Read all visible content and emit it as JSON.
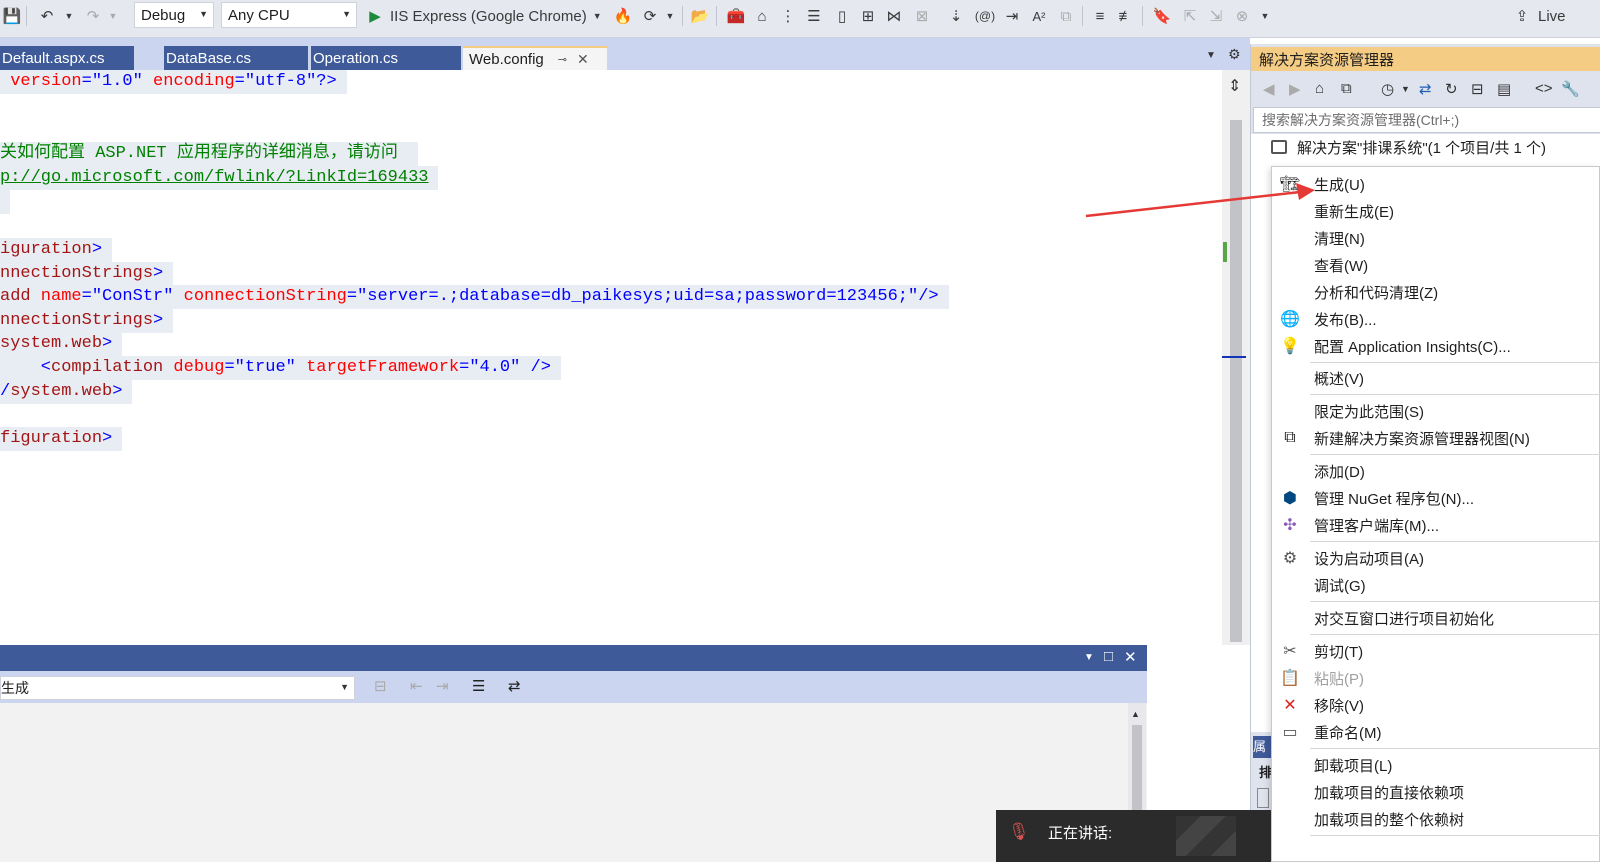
{
  "toolbar": {
    "config": "Debug",
    "platform": "Any CPU",
    "run_target": "IIS Express (Google Chrome)",
    "live_share": "Live"
  },
  "tabs": [
    {
      "label": "Default.aspx.cs",
      "active": false
    },
    {
      "label": "DataBase.cs",
      "active": false
    },
    {
      "label": "Operation.cs",
      "active": false
    },
    {
      "label": "Web.config",
      "active": true
    }
  ],
  "editor": {
    "l1": {
      "tag_open": " version",
      "eq": "=",
      "v1": "\"1.0\"",
      "a2": " encoding",
      "v2": "\"utf-8\"",
      "close": "?>"
    },
    "l2": {
      "comment": "关如何配置 ASP.NET 应用程序的详细消息，请访问 "
    },
    "l3": {
      "link": "p://go.microsoft.com/fwlink/?LinkId=169433"
    },
    "l5": {
      "text": "iguration",
      "close": ">"
    },
    "l6": {
      "text": "nnectionStrings",
      "close": ">"
    },
    "l7": {
      "tag": "add",
      "a1": " name",
      "v1": "\"ConStr\"",
      "a2": " connectionString",
      "v2": "\"server=.;database=db_paikesys;uid=sa;password=123456;\"",
      "close": "/>"
    },
    "l8": {
      "text": "nnectionStrings",
      "close": ">"
    },
    "l9": {
      "text": "system.web",
      "close": ">"
    },
    "l10": {
      "open": "    <",
      "tag": "compilation",
      "a1": " debug",
      "v1": "\"true\"",
      "a2": " targetFramework",
      "v2": "\"4.0\"",
      "close": " />"
    },
    "l11": {
      "open": "/",
      "tag": "system.web",
      "close": ">"
    },
    "l13": {
      "text": "figuration",
      "close": ">"
    }
  },
  "output": {
    "source": "生成"
  },
  "solution_explorer": {
    "title": "解决方案资源管理器",
    "search_placeholder": "搜索解决方案资源管理器(Ctrl+;)",
    "solution_label": "解决方案\"排课系统\"(1 个项目/共 1 个)"
  },
  "context_menu": {
    "items": [
      {
        "label": "生成(U)",
        "icon": "build-icon"
      },
      {
        "label": "重新生成(E)",
        "icon": ""
      },
      {
        "label": "清理(N)",
        "icon": ""
      },
      {
        "label": "查看(W)",
        "icon": ""
      },
      {
        "label": "分析和代码清理(Z)",
        "icon": ""
      },
      {
        "label": "发布(B)...",
        "icon": "publish-globe-icon"
      },
      {
        "label": "配置 Application Insights(C)...",
        "icon": "app-insights-icon"
      },
      {
        "label": "概述(V)",
        "icon": ""
      },
      {
        "label": "限定为此范围(S)",
        "icon": ""
      },
      {
        "label": "新建解决方案资源管理器视图(N)",
        "icon": "new-view-icon"
      },
      {
        "label": "添加(D)",
        "icon": ""
      },
      {
        "label": "管理 NuGet 程序包(N)...",
        "icon": "nuget-icon"
      },
      {
        "label": "管理客户端库(M)...",
        "icon": "client-libs-icon"
      },
      {
        "label": "设为启动项目(A)",
        "icon": "gear-icon"
      },
      {
        "label": "调试(G)",
        "icon": ""
      },
      {
        "label": "对交互窗口进行项目初始化",
        "icon": ""
      },
      {
        "label": "剪切(T)",
        "icon": "scissors-icon"
      },
      {
        "label": "粘贴(P)",
        "icon": "paste-icon"
      },
      {
        "label": "移除(V)",
        "icon": "remove-x-icon"
      },
      {
        "label": "重命名(M)",
        "icon": "rename-icon"
      },
      {
        "label": "卸载项目(L)",
        "icon": ""
      },
      {
        "label": "加载项目的直接依赖项",
        "icon": ""
      },
      {
        "label": "加载项目的整个依赖树",
        "icon": ""
      }
    ]
  },
  "voice": {
    "label": "正在讲话:"
  },
  "colors": {
    "accent_tab": "#3e5a99",
    "active_tab_border": "#f5cc84",
    "annotation_arrow": "#e53935"
  }
}
